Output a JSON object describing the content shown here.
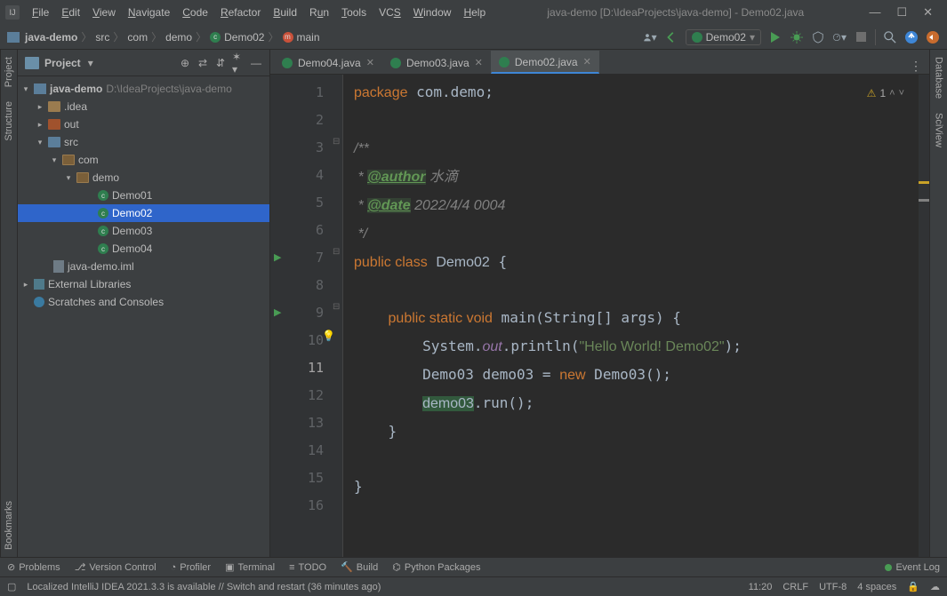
{
  "window": {
    "title": "java-demo [D:\\IdeaProjects\\java-demo] - Demo02.java",
    "menu": [
      "File",
      "Edit",
      "View",
      "Navigate",
      "Code",
      "Refactor",
      "Build",
      "Run",
      "Tools",
      "VCS",
      "Window",
      "Help"
    ]
  },
  "breadcrumb": {
    "items": [
      "java-demo",
      "src",
      "com",
      "demo",
      "Demo02",
      "main"
    ]
  },
  "runConfig": {
    "name": "Demo02"
  },
  "project": {
    "toolwindowLabel": "Project",
    "root": {
      "name": "java-demo",
      "path": "D:\\IdeaProjects\\java-demo"
    },
    "nodes": [
      {
        "name": ".idea",
        "type": "folder"
      },
      {
        "name": "out",
        "type": "folder-out"
      },
      {
        "name": "src",
        "type": "folder-src"
      },
      {
        "name": "com",
        "type": "pkg"
      },
      {
        "name": "demo",
        "type": "pkg"
      },
      {
        "name": "Demo01",
        "type": "class"
      },
      {
        "name": "Demo02",
        "type": "class"
      },
      {
        "name": "Demo03",
        "type": "class"
      },
      {
        "name": "Demo04",
        "type": "class"
      },
      {
        "name": "java-demo.iml",
        "type": "file"
      },
      {
        "name": "External Libraries",
        "type": "lib"
      },
      {
        "name": "Scratches and Consoles",
        "type": "scratch"
      }
    ]
  },
  "leftStripe": [
    "Project",
    "Structure",
    "Bookmarks"
  ],
  "rightStripe": [
    "Database",
    "SciView"
  ],
  "tabs": [
    {
      "name": "Demo04.java",
      "active": false
    },
    {
      "name": "Demo03.java",
      "active": false
    },
    {
      "name": "Demo02.java",
      "active": true
    }
  ],
  "editor": {
    "warningCount": "1",
    "currentLine": 11,
    "lines": [
      "package com.demo;",
      "",
      "/**",
      " * @author 水滴",
      " * @date 2022/4/4 0004",
      " */",
      "public class Demo02 {",
      "",
      "    public static void main(String[] args) {",
      "        System.out.println(\"Hello World! Demo02\");",
      "        Demo03 demo03 = new Demo03();",
      "        demo03.run();",
      "    }",
      "",
      "}",
      ""
    ]
  },
  "bottomTools": [
    "Problems",
    "Version Control",
    "Profiler",
    "Terminal",
    "TODO",
    "Build",
    "Python Packages"
  ],
  "eventLog": "Event Log",
  "status": {
    "message": "Localized IntelliJ IDEA 2021.3.3 is available // Switch and restart (36 minutes ago)",
    "time": "11:20",
    "lineSep": "CRLF",
    "encoding": "UTF-8",
    "indent": "4 spaces"
  }
}
